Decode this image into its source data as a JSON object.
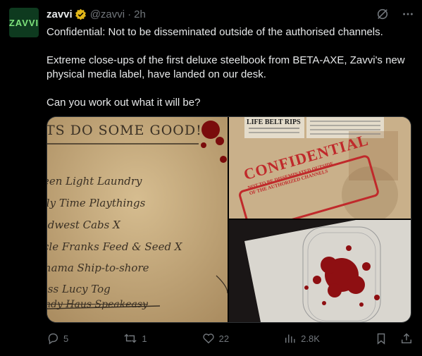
{
  "account": {
    "avatar_text": "ZAVVI",
    "name": "zavvi",
    "handle": "@zavvi",
    "separator": "·",
    "time": "2h"
  },
  "tweet": {
    "paragraphs": [
      "Confidential: Not to be disseminated outside of the authorised channels.",
      "Extreme close-ups of the first deluxe steelbook from BETA-AXE, Zavvi's new physical media label, have landed on our desk.",
      "Can you work out what it will be?"
    ]
  },
  "media": {
    "image1_lines": [
      "TS DO SOME GOOD!",
      "een Light Laundry",
      "lly Time Playthings",
      "idwest Cabs X",
      "cle Franks Feed & Seed X",
      "hama Ship-to-shore",
      "iss Lucy Tog",
      "ndy Haus Speakeasy"
    ],
    "image2_headline": "LIFE BELT RIPS",
    "image2_stamp_main": "CONFIDENTIAL",
    "image2_stamp_sub1": "NOT TO BE DISSEMINATED OUTSIDE",
    "image2_stamp_sub2": "OF THE AUTHORIZED CHANNELS"
  },
  "actions": {
    "replies": "5",
    "reposts": "1",
    "likes": "22",
    "views": "2.8K"
  },
  "colors": {
    "background": "#000000",
    "text": "#e7e9ea",
    "muted": "#71767b",
    "verified": "#e2b719",
    "stamp_red": "#c0292b",
    "blood": "#8e0f12"
  },
  "icons": {
    "verified": "gold-verified-badge-icon",
    "grok": "grok-icon",
    "more": "more-icon",
    "reply": "reply-icon",
    "repost": "repost-icon",
    "like": "heart-icon",
    "views": "views-icon",
    "bookmark": "bookmark-icon",
    "share": "share-icon"
  }
}
